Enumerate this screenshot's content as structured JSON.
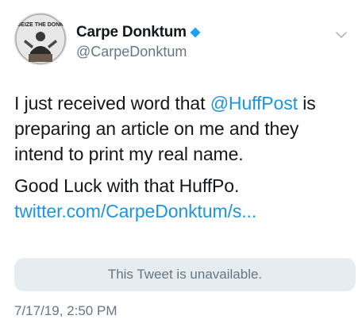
{
  "avatar": {
    "caption": "SEIZE THE DONK"
  },
  "author": {
    "display_name": "Carpe Donktum",
    "handle": "@CarpeDonktum",
    "verified_color": "#1da1f2"
  },
  "tweet": {
    "line1_prefix": "I just received word that ",
    "mention": "@HuffPost",
    "line1_suffix": " is preparing an article on me and they intend to print my real name.",
    "paragraph2": "Good Luck with that HuffPo.",
    "link": "twitter.com/CarpeDonktum/s..."
  },
  "quoted": {
    "unavailable_text": "This Tweet is unavailable."
  },
  "timestamp": "7/17/19, 2:50 PM",
  "colors": {
    "link": "#1b95e0",
    "secondary_text": "#657786",
    "card_bg": "#e6ecf0"
  },
  "icons": {
    "verified": "verified-badge-icon",
    "menu": "chevron-down-icon"
  }
}
